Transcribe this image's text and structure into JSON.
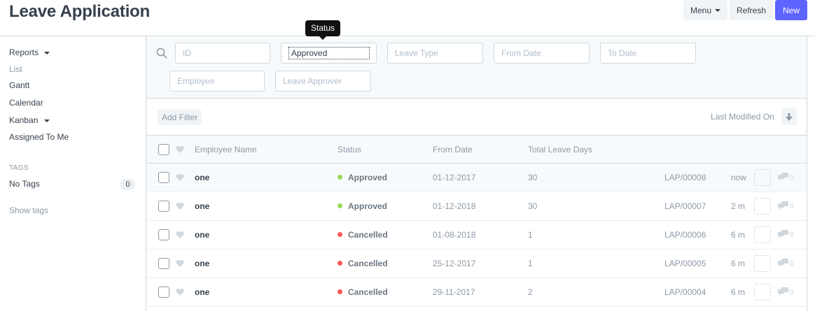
{
  "header": {
    "title": "Leave Application",
    "menu_label": "Menu",
    "refresh_label": "Refresh",
    "new_label": "New"
  },
  "sidebar": {
    "reports": "Reports",
    "list": "List",
    "gantt": "Gantt",
    "calendar": "Calendar",
    "kanban": "Kanban",
    "assigned": "Assigned To Me",
    "tags_heading": "TAGS",
    "no_tags": "No Tags",
    "tag_count": "0",
    "show_tags": "Show tags"
  },
  "filters": {
    "id_placeholder": "ID",
    "status_value": "Approved",
    "leave_type_placeholder": "Leave Type",
    "from_date_placeholder": "From Date",
    "to_date_placeholder": "To Date",
    "employee_placeholder": "Employee",
    "approver_placeholder": "Leave Approver",
    "tooltip": "Status"
  },
  "toolbar": {
    "add_filter": "Add Filter",
    "sort_label": "Last Modified On"
  },
  "columns": {
    "employee_name": "Employee Name",
    "status": "Status",
    "from_date": "From Date",
    "total_leave_days": "Total Leave Days"
  },
  "colors": {
    "approved": "#98d85b",
    "cancelled": "#ff5858",
    "primary": "#5e64ff"
  },
  "rows": [
    {
      "name": "one",
      "status": "Approved",
      "from_date": "01-12-2017",
      "days": "30",
      "id": "LAP/00008",
      "modified": "now",
      "comments": "0"
    },
    {
      "name": "one",
      "status": "Approved",
      "from_date": "01-12-2018",
      "days": "30",
      "id": "LAP/00007",
      "modified": "2 m",
      "comments": "0"
    },
    {
      "name": "one",
      "status": "Cancelled",
      "from_date": "01-08-2018",
      "days": "1",
      "id": "LAP/00006",
      "modified": "6 m",
      "comments": "0"
    },
    {
      "name": "one",
      "status": "Cancelled",
      "from_date": "25-12-2017",
      "days": "1",
      "id": "LAP/00005",
      "modified": "6 m",
      "comments": "0"
    },
    {
      "name": "one",
      "status": "Cancelled",
      "from_date": "29-11-2017",
      "days": "2",
      "id": "LAP/00004",
      "modified": "6 m",
      "comments": "0"
    }
  ]
}
